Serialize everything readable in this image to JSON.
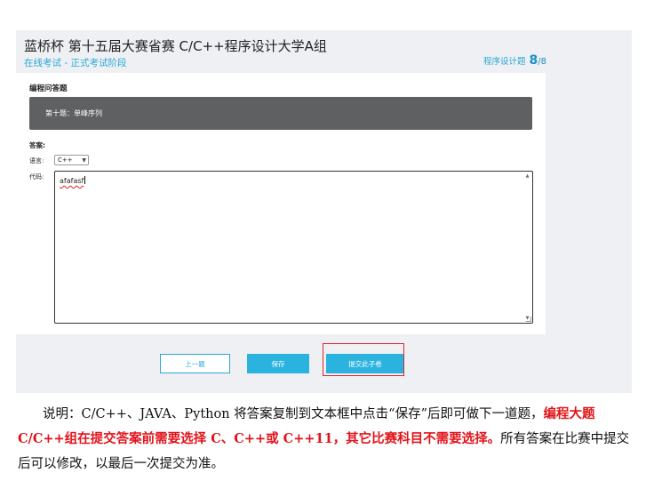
{
  "exam": {
    "title": "蓝桥杯 第十五届大赛省赛 C/C++程序设计大学A组",
    "stage": "在线考试 - 正式考试阶段",
    "progress_label": "程序设计题",
    "progress_current": "8",
    "progress_total": "/8"
  },
  "panel": {
    "heading": "编程问答题",
    "question": "第十题：单峰序列",
    "answer_label": "答案:",
    "language_label": "语言:",
    "language_selected": "C++",
    "code_label": "代码:",
    "code_value": "afafasf"
  },
  "buttons": {
    "prev": "上一题",
    "save": "保存",
    "submit": "提交此子卷"
  },
  "colors": {
    "accent": "#2bb3e0",
    "question_bar": "#5f6061",
    "highlight": "#d9262e",
    "emphasis": "#e1141b"
  },
  "caption": {
    "part1": "说明：C/C++、JAVA、Python 将答案复制到文本框中点击“保存”后即可做下一道题，",
    "part2": "编程大题 C/C++组在提交答案前需要选择 C、C++或 C++11，其它比赛科目不需要选择。",
    "part3": "所有答案在比赛中提交后可以修改，以最后一次提交为准。"
  }
}
